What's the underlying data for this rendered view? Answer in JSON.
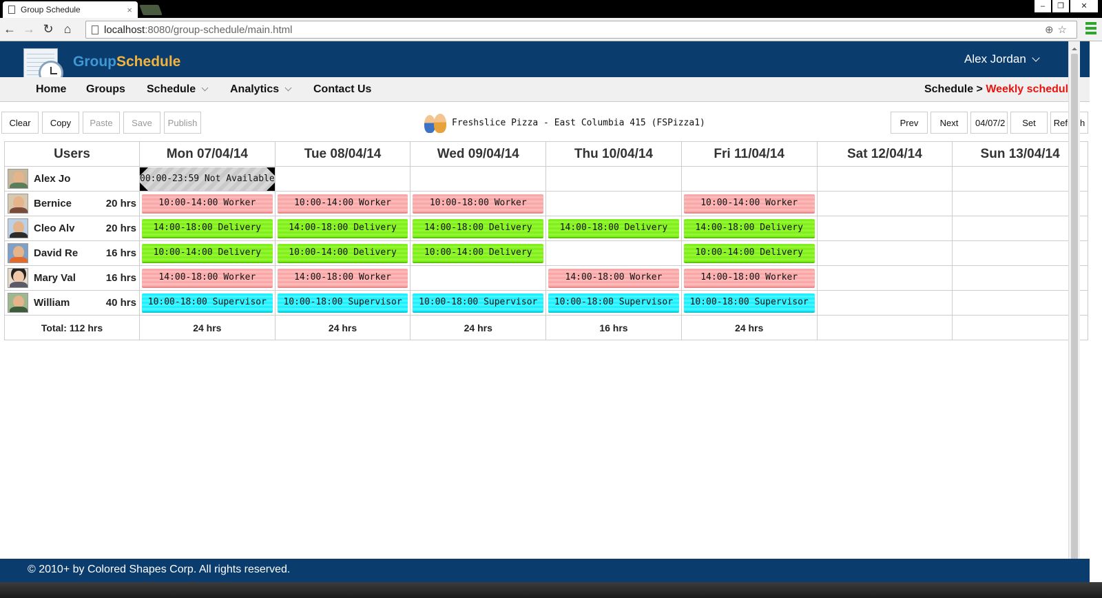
{
  "browser": {
    "tab_title": "Group Schedule",
    "tab_close": "×",
    "url_host": "localhost",
    "url_path": ":8080/group-schedule/main.html",
    "window_controls": [
      "‒",
      "❐",
      "✕"
    ]
  },
  "app": {
    "brand_part1": "Group",
    "brand_part2": "Schedule",
    "user_name": "Alex  Jordan"
  },
  "nav": {
    "items": [
      {
        "label": "Home",
        "dropdown": false
      },
      {
        "label": "Groups",
        "dropdown": false
      },
      {
        "label": "Schedule",
        "dropdown": true
      },
      {
        "label": "Analytics",
        "dropdown": true
      },
      {
        "label": "Contact Us",
        "dropdown": false
      }
    ],
    "breadcrumb_parent": "Schedule >",
    "breadcrumb_current": "Weekly schedule"
  },
  "actions": {
    "clear": "Clear",
    "copy": "Copy",
    "paste": "Paste",
    "save": "Save",
    "publish": "Publish",
    "prev": "Prev",
    "next": "Next",
    "date_value": "04/07/2",
    "set": "Set",
    "refresh": "Refresh"
  },
  "group_label": "Freshslice Pizza - East Columbia 415 (FSPizza1)",
  "schedule": {
    "users_header": "Users",
    "days": [
      "Mon 07/04/14",
      "Tue 08/04/14",
      "Wed 09/04/14",
      "Thu 10/04/14",
      "Fri 11/04/14",
      "Sat 12/04/14",
      "Sun 13/04/14"
    ],
    "rows": [
      {
        "name": "Alex  Jo",
        "hours": "",
        "shifts": [
          {
            "text": "00:00-23:59 Not Available",
            "type": "na"
          },
          null,
          null,
          null,
          null,
          null,
          null
        ]
      },
      {
        "name": "Bernice",
        "hours": "20 hrs",
        "shifts": [
          {
            "text": "10:00-14:00 Worker",
            "type": "worker"
          },
          {
            "text": "10:00-14:00 Worker",
            "type": "worker"
          },
          {
            "text": "10:00-18:00 Worker",
            "type": "worker"
          },
          null,
          {
            "text": "10:00-14:00 Worker",
            "type": "worker"
          },
          null,
          null
        ]
      },
      {
        "name": "Cleo Alv",
        "hours": "20 hrs",
        "shifts": [
          {
            "text": "14:00-18:00 Delivery",
            "type": "delivery"
          },
          {
            "text": "14:00-18:00 Delivery",
            "type": "delivery"
          },
          {
            "text": "14:00-18:00 Delivery",
            "type": "delivery"
          },
          {
            "text": "14:00-18:00 Delivery",
            "type": "delivery"
          },
          {
            "text": "14:00-18:00 Delivery",
            "type": "delivery"
          },
          null,
          null
        ]
      },
      {
        "name": "David Re",
        "hours": "16 hrs",
        "shifts": [
          {
            "text": "10:00-14:00 Delivery",
            "type": "delivery"
          },
          {
            "text": "10:00-14:00 Delivery",
            "type": "delivery"
          },
          {
            "text": "10:00-14:00 Delivery",
            "type": "delivery"
          },
          null,
          {
            "text": "10:00-14:00 Delivery",
            "type": "delivery"
          },
          null,
          null
        ]
      },
      {
        "name": "Mary Val",
        "hours": "16 hrs",
        "shifts": [
          {
            "text": "14:00-18:00 Worker",
            "type": "worker"
          },
          {
            "text": "14:00-18:00 Worker",
            "type": "worker"
          },
          null,
          {
            "text": "14:00-18:00 Worker",
            "type": "worker"
          },
          {
            "text": "14:00-18:00 Worker",
            "type": "worker"
          },
          null,
          null
        ]
      },
      {
        "name": "William",
        "hours": "40 hrs",
        "shifts": [
          {
            "text": "10:00-18:00 Supervisor",
            "type": "supervisor"
          },
          {
            "text": "10:00-18:00 Supervisor",
            "type": "supervisor"
          },
          {
            "text": "10:00-18:00 Supervisor",
            "type": "supervisor"
          },
          {
            "text": "10:00-18:00 Supervisor",
            "type": "supervisor"
          },
          {
            "text": "10:00-18:00 Supervisor",
            "type": "supervisor"
          },
          null,
          null
        ]
      }
    ],
    "total_label": "Total: 112 hrs",
    "day_totals": [
      "24 hrs",
      "24 hrs",
      "24 hrs",
      "16 hrs",
      "24 hrs",
      "",
      ""
    ]
  },
  "footer": "© 2010+ by Colored Shapes Corp. All rights reserved.",
  "colors": {
    "header_bg": "#0b3c6e",
    "brand_blue": "#3f97d4",
    "brand_orange": "#f4b43b",
    "breadcrumb_active": "#e8140e",
    "worker": "#f9a7a7",
    "delivery": "#7ff01c",
    "supervisor": "#1ef0ff",
    "not_available": "#d8d8d8"
  }
}
